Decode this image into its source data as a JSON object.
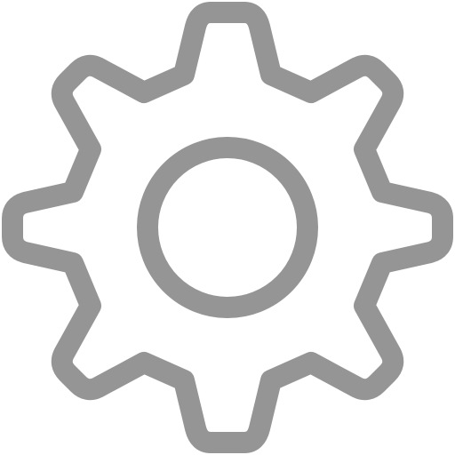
{
  "icon": {
    "name": "gear-icon",
    "stroke_color": "#959595",
    "fill_color": "#ffffff"
  }
}
